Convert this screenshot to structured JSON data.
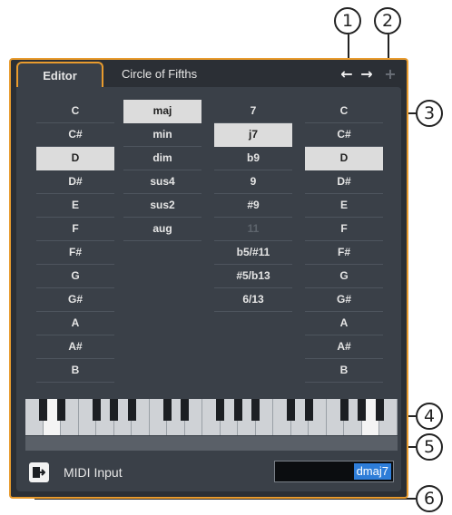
{
  "callouts": [
    "1",
    "2",
    "3",
    "4",
    "5",
    "6"
  ],
  "tabs": {
    "editor": "Editor",
    "circle": "Circle of Fifths"
  },
  "nav": {
    "back": "←",
    "forward": "→",
    "add": "+"
  },
  "columns": {
    "root": [
      "C",
      "C#",
      "D",
      "D#",
      "E",
      "F",
      "F#",
      "G",
      "G#",
      "A",
      "A#",
      "B"
    ],
    "type": [
      "maj",
      "min",
      "dim",
      "sus4",
      "sus2",
      "aug"
    ],
    "tension": [
      "7",
      "j7",
      "b9",
      "9",
      "#9",
      "11",
      "b5/#11",
      "#5/b13",
      "6/13"
    ],
    "bass": [
      "C",
      "C#",
      "D",
      "D#",
      "E",
      "F",
      "F#",
      "G",
      "G#",
      "A",
      "A#",
      "B"
    ]
  },
  "selected": {
    "root": "D",
    "type": "maj",
    "tension": "j7",
    "bass": "D"
  },
  "disabled_tension": "11",
  "midi": {
    "label": "MIDI Input"
  },
  "chord_field": {
    "value": "dmaj7"
  },
  "colors": {
    "accent": "#e89b2e",
    "panel": "#3a4048",
    "selection": "#2e7dd8"
  }
}
